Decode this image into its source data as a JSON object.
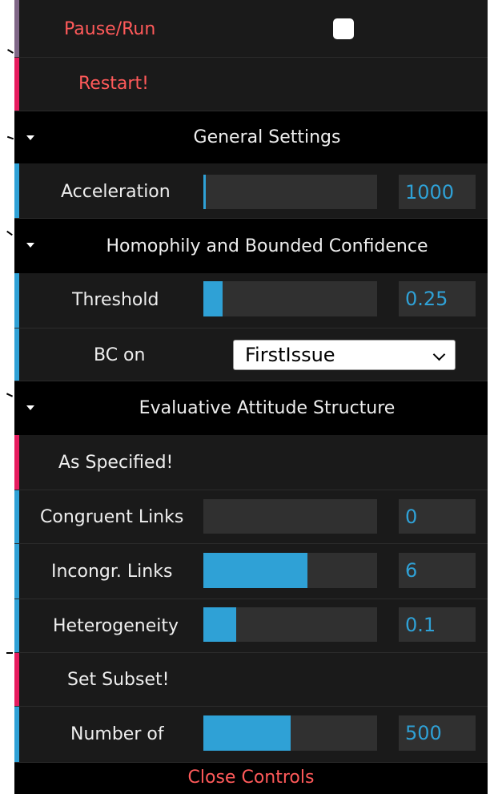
{
  "controls": {
    "pause_run": "Pause/Run",
    "restart": "Restart!",
    "sections": {
      "general": "General Settings",
      "homophily": "Homophily and Bounded Confidence",
      "evaluative": "Evaluative Attitude Structure"
    },
    "acceleration": {
      "label": "Acceleration",
      "value": "1000",
      "fraction": 0.01
    },
    "threshold": {
      "label": "Threshold",
      "value": "0.25",
      "fraction": 0.11
    },
    "bc_on": {
      "label": "BC on",
      "selected": "FirstIssue"
    },
    "as_specified": "As Specified!",
    "congruent": {
      "label": "Congruent Links",
      "value": "0",
      "fraction": 0.0
    },
    "incongruent": {
      "label": "Incongr. Links",
      "value": "6",
      "fraction": 0.6
    },
    "heterogeneity": {
      "label": "Heterogeneity",
      "value": "0.1",
      "fraction": 0.19
    },
    "set_subset": "Set Subset!",
    "number_of": {
      "label": "Number of",
      "value": "500",
      "fraction": 0.5
    },
    "close": "Close Controls"
  },
  "colors": {
    "function_bar": "#e61d5f",
    "number_bar": "#2fa1d6",
    "boolean_bar": "#806787",
    "function_text": "#ff5a5a",
    "value_text": "#2fa1d6"
  }
}
